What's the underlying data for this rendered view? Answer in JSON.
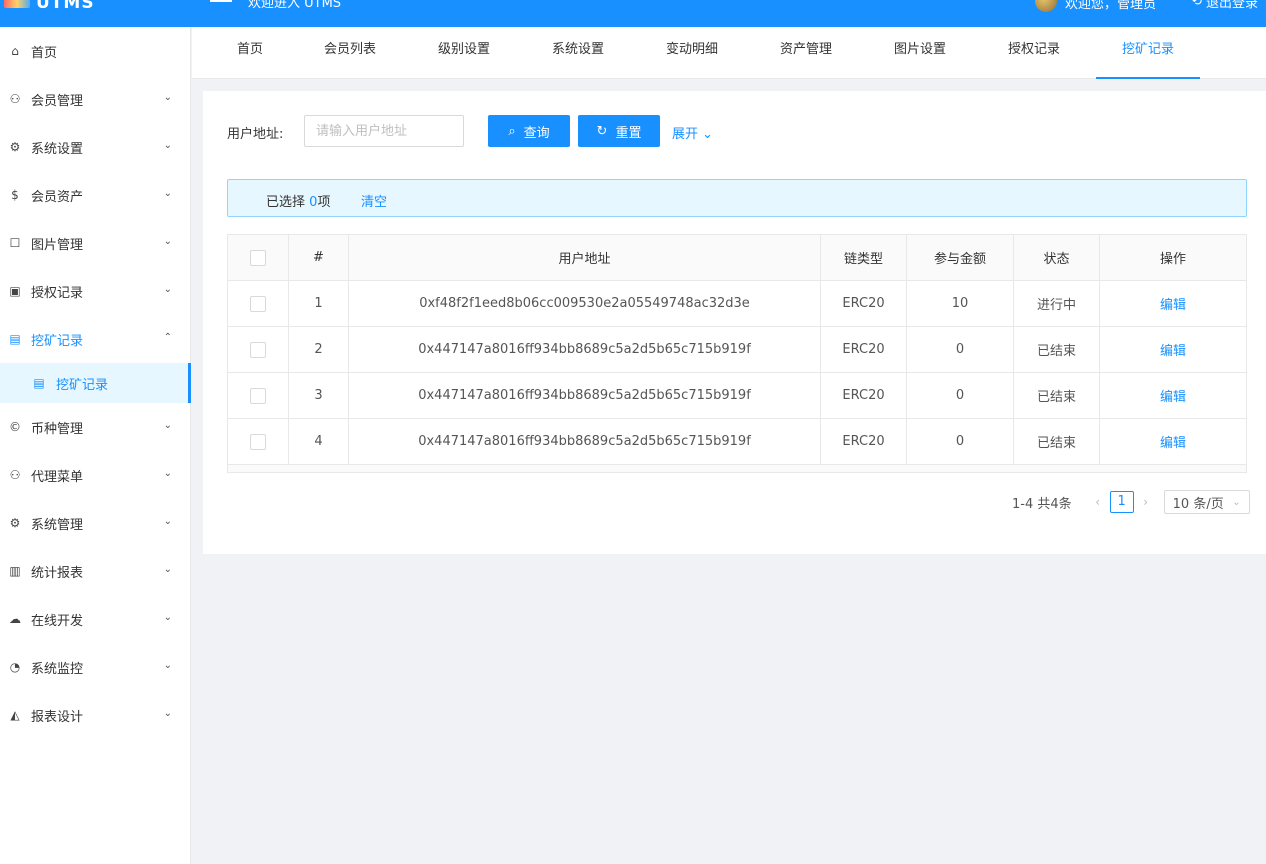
{
  "header": {
    "logo_text": "UTMS",
    "welcome": "欢迎进入 UTMS",
    "user_greeting": "欢迎您，管理员",
    "logout": "退出登录"
  },
  "sidebar": {
    "items": [
      {
        "label": "首页",
        "icon": "home-icon"
      },
      {
        "label": "会员管理",
        "icon": "user-icon"
      },
      {
        "label": "系统设置",
        "icon": "gear-icon"
      },
      {
        "label": "会员资产",
        "icon": "dollar-icon"
      },
      {
        "label": "图片管理",
        "icon": "square-icon"
      },
      {
        "label": "授权记录",
        "icon": "picture-icon"
      },
      {
        "label": "挖矿记录",
        "icon": "list-icon"
      },
      {
        "label": "挖矿记录",
        "icon": "list-icon"
      },
      {
        "label": "币种管理",
        "icon": "copyright-icon"
      },
      {
        "label": "代理菜单",
        "icon": "user-icon"
      },
      {
        "label": "系统管理",
        "icon": "gear-icon"
      },
      {
        "label": "统计报表",
        "icon": "bar-chart-icon"
      },
      {
        "label": "在线开发",
        "icon": "cloud-icon"
      },
      {
        "label": "系统监控",
        "icon": "dashboard-icon"
      },
      {
        "label": "报表设计",
        "icon": "area-chart-icon"
      }
    ]
  },
  "tabs": [
    {
      "label": "首页"
    },
    {
      "label": "会员列表"
    },
    {
      "label": "级别设置"
    },
    {
      "label": "系统设置"
    },
    {
      "label": "变动明细"
    },
    {
      "label": "资产管理"
    },
    {
      "label": "图片设置"
    },
    {
      "label": "授权记录"
    },
    {
      "label": "挖矿记录"
    }
  ],
  "filter": {
    "label": "用户地址:",
    "placeholder": "请输入用户地址",
    "query": "查询",
    "reset": "重置",
    "expand": "展开"
  },
  "selection": {
    "prefix": "已选择",
    "count": "0",
    "suffix": "项",
    "clear": "清空"
  },
  "table": {
    "headers": [
      "#",
      "用户地址",
      "链类型",
      "参与金额",
      "状态",
      "操作"
    ],
    "rows": [
      {
        "idx": "1",
        "address": "0xf48f2f1eed8b06cc009530e2a05549748ac32d3e",
        "chain": "ERC20",
        "amount": "10",
        "status": "进行中",
        "op": "编辑"
      },
      {
        "idx": "2",
        "address": "0x447147a8016ff934bb8689c5a2d5b65c715b919f",
        "chain": "ERC20",
        "amount": "0",
        "status": "已结束",
        "op": "编辑"
      },
      {
        "idx": "3",
        "address": "0x447147a8016ff934bb8689c5a2d5b65c715b919f",
        "chain": "ERC20",
        "amount": "0",
        "status": "已结束",
        "op": "编辑"
      },
      {
        "idx": "4",
        "address": "0x447147a8016ff934bb8689c5a2d5b65c715b919f",
        "chain": "ERC20",
        "amount": "0",
        "status": "已结束",
        "op": "编辑"
      }
    ]
  },
  "pagination": {
    "total": "1-4 共4条",
    "current": "1",
    "page_size": "10 条/页"
  }
}
